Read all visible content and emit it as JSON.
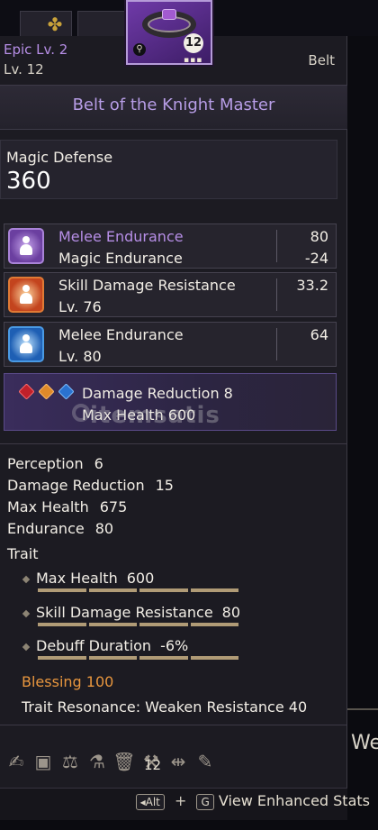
{
  "header": {
    "grade": "Epic Lv. 2",
    "level": "Lv. 12",
    "type": "Belt",
    "item_level_badge": "12"
  },
  "title": "Belt of the Knight Master",
  "primary": {
    "label": "Magic Defense",
    "value": "360"
  },
  "stat_rows": [
    {
      "icon": "purple-gem-icon",
      "line1": "Melee Endurance",
      "val1": "80",
      "line2": "Magic Endurance",
      "val2": "-24"
    },
    {
      "icon": "orange-gem-icon",
      "line1": "Skill Damage Resistance",
      "val1": "33.2",
      "line2": "Lv. 76"
    },
    {
      "icon": "blue-gem-icon",
      "line1": "Melee Endurance",
      "val1": "64",
      "line2": "Lv. 80"
    }
  ],
  "set_bonus": {
    "line1": "Damage Reduction 8",
    "line2": "Max Health 600"
  },
  "watermark": "itemsatis",
  "attributes": [
    {
      "label": "Perception",
      "value": "6"
    },
    {
      "label": "Damage Reduction",
      "value": "15"
    },
    {
      "label": "Max Health",
      "value": "675"
    },
    {
      "label": "Endurance",
      "value": "80"
    }
  ],
  "trait": {
    "title": "Trait",
    "items": [
      {
        "label": "Max Health",
        "value": "600"
      },
      {
        "label": "Skill Damage Resistance",
        "value": "80"
      },
      {
        "label": "Debuff Duration",
        "value": "-6%"
      }
    ]
  },
  "blessing": "Blessing 100",
  "resonance": "Trait Resonance: Weaken Resistance 40",
  "toolbar": {
    "count": "12"
  },
  "footer": {
    "key1": "Alt",
    "plus": "+",
    "key2": "G",
    "label": "View Enhanced Stats"
  },
  "outside_text": "We",
  "colors": {
    "epic": "#b68ee6",
    "blessing": "#e8963e",
    "magic_endurance_negative": "#f2eee6"
  }
}
